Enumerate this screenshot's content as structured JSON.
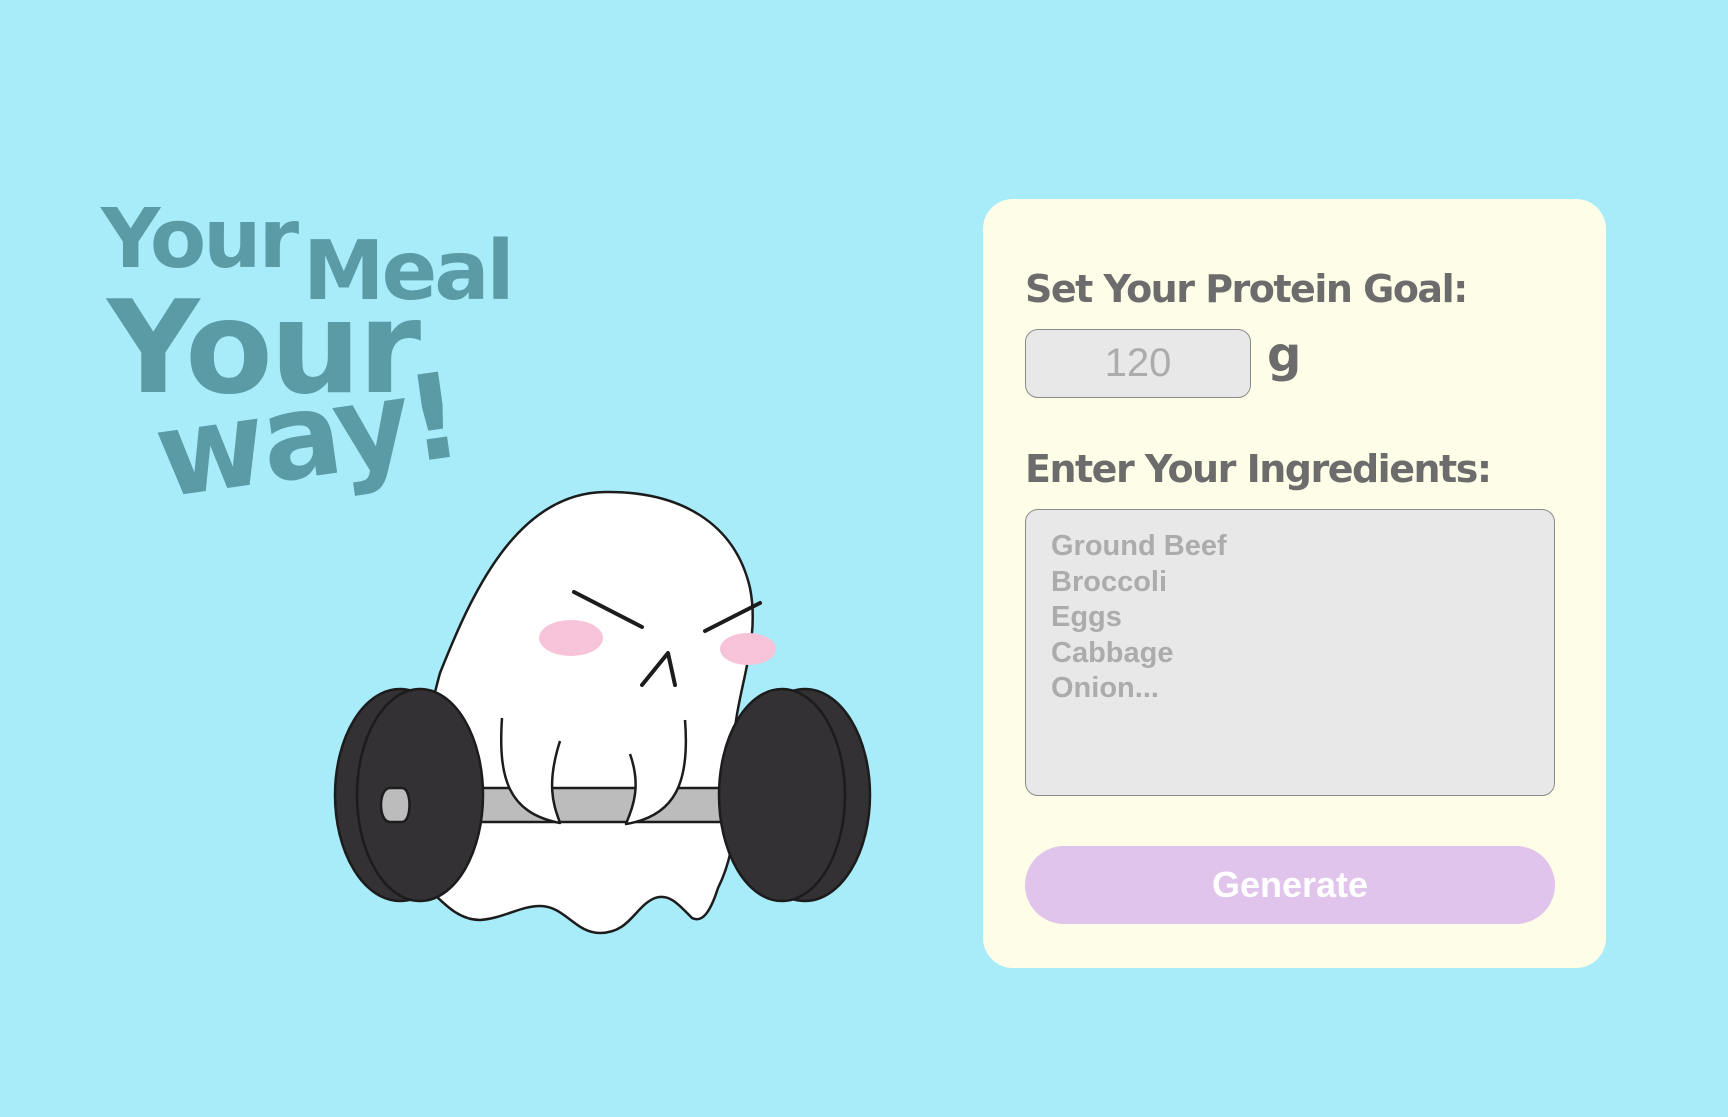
{
  "headline": {
    "line1_word1": "Your",
    "line1_word2": "Meal",
    "line2": "Your",
    "line3": "way!"
  },
  "form": {
    "protein_label": "Set Your Protein Goal:",
    "protein_placeholder": "120",
    "protein_unit": "g",
    "ingredients_label": "Enter Your Ingredients:",
    "ingredients_placeholder": "Ground Beef\nBroccoli\nEggs\nCabbage\nOnion...",
    "generate_label": "Generate"
  },
  "colors": {
    "background": "#a8ecfa",
    "headline": "#5a9ba6",
    "card": "#fefee8",
    "label": "#6c6c6c",
    "input_bg": "#e8e8e8",
    "placeholder": "#acacac",
    "button": "#e0c4ec",
    "blush": "#f7c3d8"
  },
  "illustration": {
    "icon": "ghost-lifting-barbell-icon"
  }
}
